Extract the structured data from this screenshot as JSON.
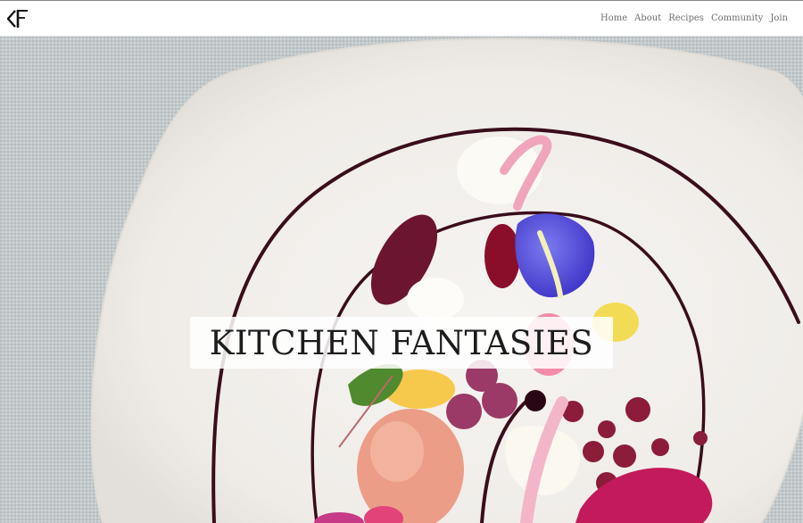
{
  "brand": {
    "logo_icon": "kf-monogram-logo"
  },
  "nav": {
    "items": [
      {
        "label": "Home"
      },
      {
        "label": "About"
      },
      {
        "label": "Recipes"
      },
      {
        "label": "Community"
      },
      {
        "label": "Join"
      }
    ]
  },
  "hero": {
    "title": "KITCHEN FANTASIES",
    "image": "plated-dish-photo"
  },
  "colors": {
    "nav_text": "#6d6d6d",
    "title_text": "#1c1c1c",
    "tablecloth": "#c4cacc",
    "plate": "#f3f1ee",
    "sauce": "#3a0d1c"
  }
}
